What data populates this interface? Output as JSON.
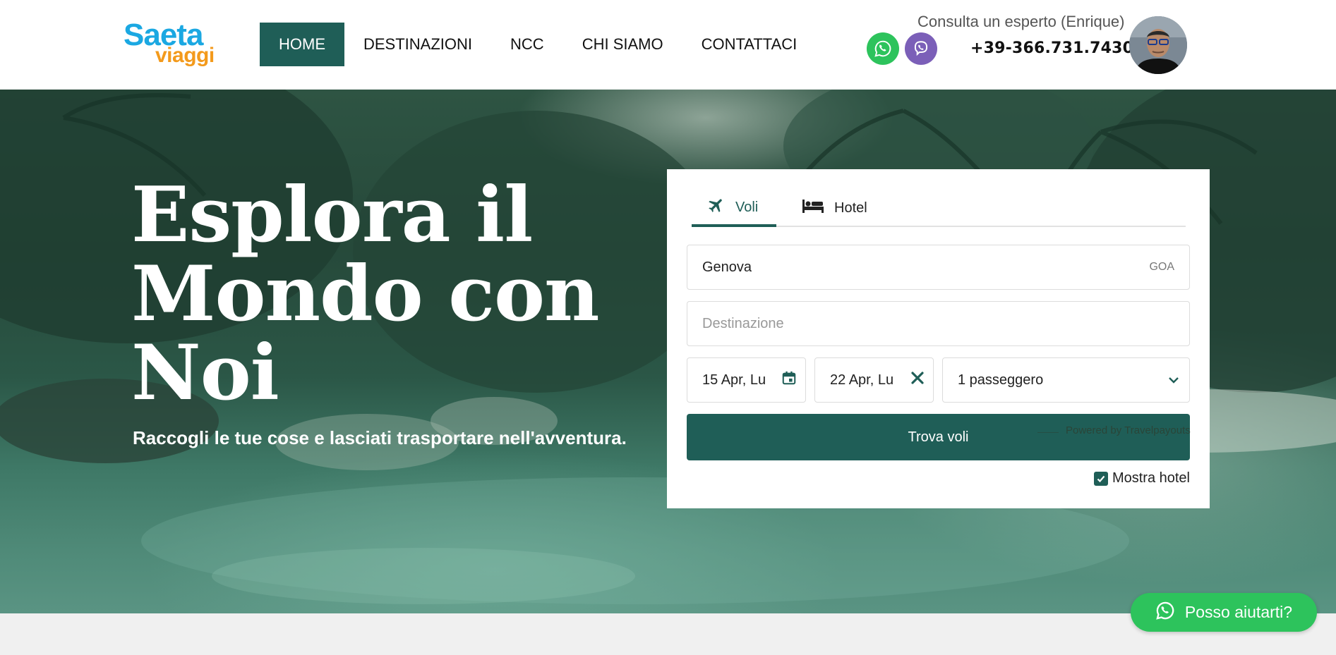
{
  "header": {
    "logo": {
      "line1": "Saeta",
      "line2": "viaggi"
    },
    "nav": [
      {
        "label": "HOME",
        "active": true
      },
      {
        "label": "DESTINAZIONI",
        "active": false
      },
      {
        "label": "NCC",
        "active": false
      },
      {
        "label": "CHI SIAMO",
        "active": false
      },
      {
        "label": "CONTATTACI",
        "active": false
      }
    ],
    "expert_label": "Consulta un esperto (Enrique)",
    "phone": "+39-366.731.7430",
    "icons": {
      "whatsapp": "whatsapp-icon",
      "viber": "viber-icon"
    }
  },
  "hero": {
    "title": "Esplora il Mondo con Noi",
    "subtitle": "Raccogli le tue cose e lasciati trasportare nell'avventura."
  },
  "search": {
    "tabs": [
      {
        "label": "Voli",
        "icon": "plane-icon",
        "active": true
      },
      {
        "label": "Hotel",
        "icon": "bed-icon",
        "active": false
      }
    ],
    "origin": {
      "value": "Genova",
      "code": "GOA"
    },
    "destination": {
      "placeholder": "Destinazione",
      "value": ""
    },
    "depart_date": "15 Apr, Lu",
    "return_date": "22 Apr, Lu",
    "passengers": "1 passeggero",
    "submit_label": "Trova voli",
    "show_hotels_label": "Mostra hotel",
    "show_hotels_checked": true,
    "powered_by": "Powered by Travelpayouts"
  },
  "floating": {
    "help_label": "Posso aiutarti?"
  },
  "colors": {
    "primary": "#1f5e57",
    "whatsapp": "#2dc35c",
    "viber": "#7b5fb8",
    "logo_blue": "#1ba8e2",
    "logo_orange": "#f39a1c"
  }
}
